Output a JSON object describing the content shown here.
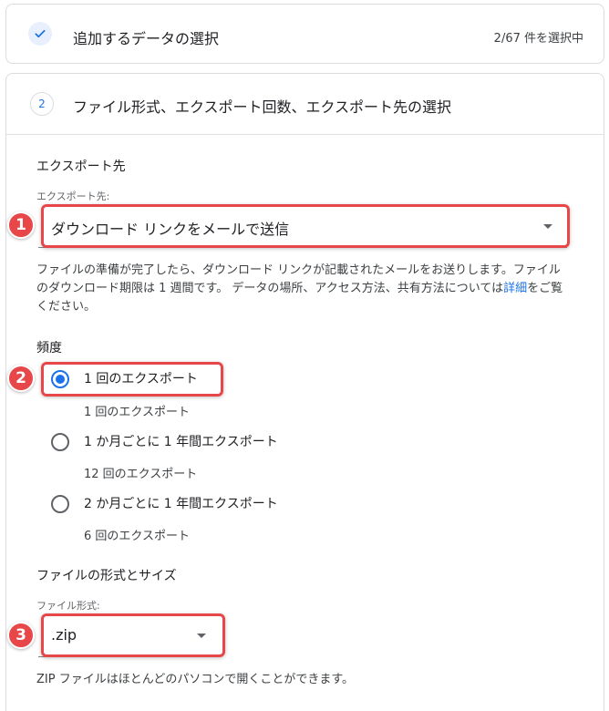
{
  "step1": {
    "title": "追加するデータの選択",
    "count": "2/67 件を選択中"
  },
  "step2": {
    "number": "2",
    "title": "ファイル形式、エクスポート回数、エクスポート先の選択"
  },
  "destination": {
    "section_label": "エクスポート先",
    "field_label": "エクスポート先:",
    "selected": "ダウンロード リンクをメールで送信",
    "badge": "1",
    "description_pre": "ファイルの準備が完了したら、ダウンロード リンクが記載されたメールをお送りします。ファイルのダウンロード期限は 1 週間です。 データの場所、アクセス方法、共有方法については",
    "description_link": "詳細",
    "description_post": "をご覧ください。"
  },
  "frequency": {
    "section_label": "頻度",
    "badge": "2",
    "options": [
      {
        "label": "1 回のエクスポート",
        "sub": "1 回のエクスポート",
        "checked": true
      },
      {
        "label": "1 か月ごとに 1 年間エクスポート",
        "sub": "12 回のエクスポート",
        "checked": false
      },
      {
        "label": "2 か月ごとに 1 年間エクスポート",
        "sub": "6 回のエクスポート",
        "checked": false
      }
    ]
  },
  "file_format": {
    "section_label": "ファイルの形式とサイズ",
    "field_label": "ファイル形式:",
    "selected": ".zip",
    "badge": "3",
    "description": "ZIP ファイルはほとんどのパソコンで開くことができます。"
  },
  "colors": {
    "accent": "#1a73e8",
    "annotation_red": "#e8474a"
  }
}
